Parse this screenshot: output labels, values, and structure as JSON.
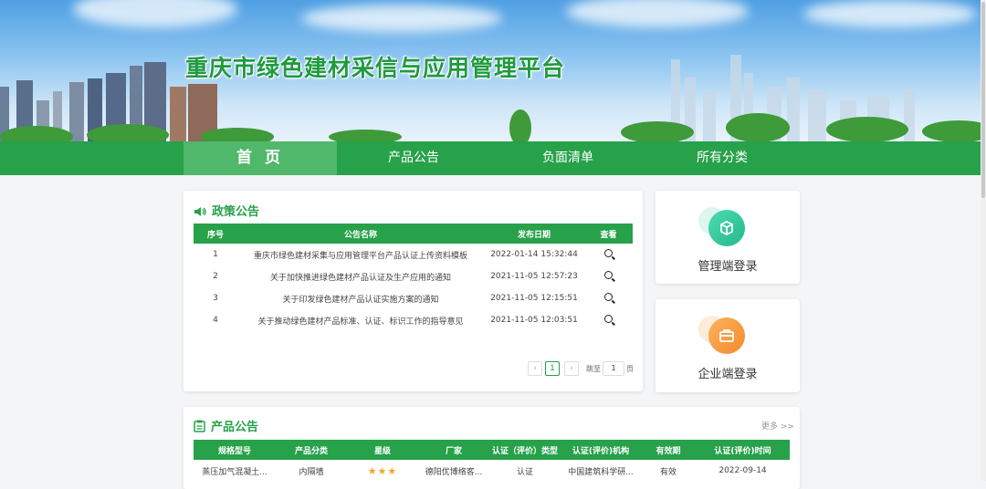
{
  "site": {
    "title": "重庆市绿色建材采信与应用管理平台"
  },
  "nav": {
    "items": [
      {
        "label": "首 页"
      },
      {
        "label": "产品公告"
      },
      {
        "label": "负面清单"
      },
      {
        "label": "所有分类"
      }
    ]
  },
  "policy": {
    "title": "政策公告",
    "headers": [
      "序号",
      "公告名称",
      "发布日期",
      "查看"
    ],
    "rows": [
      {
        "no": "1",
        "name": "重庆市绿色建材采集与应用管理平台产品认证上传资料模板",
        "date": "2022-01-14 15:32:44"
      },
      {
        "no": "2",
        "name": "关于加快推进绿色建材产品认证及生产应用的通知",
        "date": "2021-11-05 12:57:23"
      },
      {
        "no": "3",
        "name": "关于印发绿色建材产品认证实施方案的通知",
        "date": "2021-11-05 12:15:51"
      },
      {
        "no": "4",
        "name": "关于推动绿色建材产品标准、认证、标识工作的指导意见",
        "date": "2021-11-05 12:03:51"
      }
    ],
    "pager": {
      "prev": "‹",
      "current": "1",
      "next": "›",
      "goto_label": "跳至",
      "goto_value": "1",
      "page_unit": "页"
    }
  },
  "login": {
    "admin_label": "管理端登录",
    "enterprise_label": "企业端登录"
  },
  "product": {
    "title": "产品公告",
    "more": "更多 >>",
    "headers": [
      "规格型号",
      "产品分类",
      "星级",
      "厂家",
      "认证（评价）类型",
      "认证(评价)机构",
      "有效期",
      "认证(评价)时间"
    ],
    "rows": [
      {
        "model": "蒸压加气混凝土...",
        "category": "内隔墙",
        "stars": "★★★",
        "maker": "德阳优博络客...",
        "type": "认证",
        "org": "中国建筑科学研...",
        "validity": "有效",
        "time": "2022-09-14"
      }
    ]
  },
  "colors": {
    "primary": "#27a14a",
    "nav_active": "#4fb86a",
    "title_green": "#1f9a40",
    "admin_icon": "#2fcca0",
    "enterprise_icon": "#f79a3e",
    "star": "#f5a623"
  }
}
